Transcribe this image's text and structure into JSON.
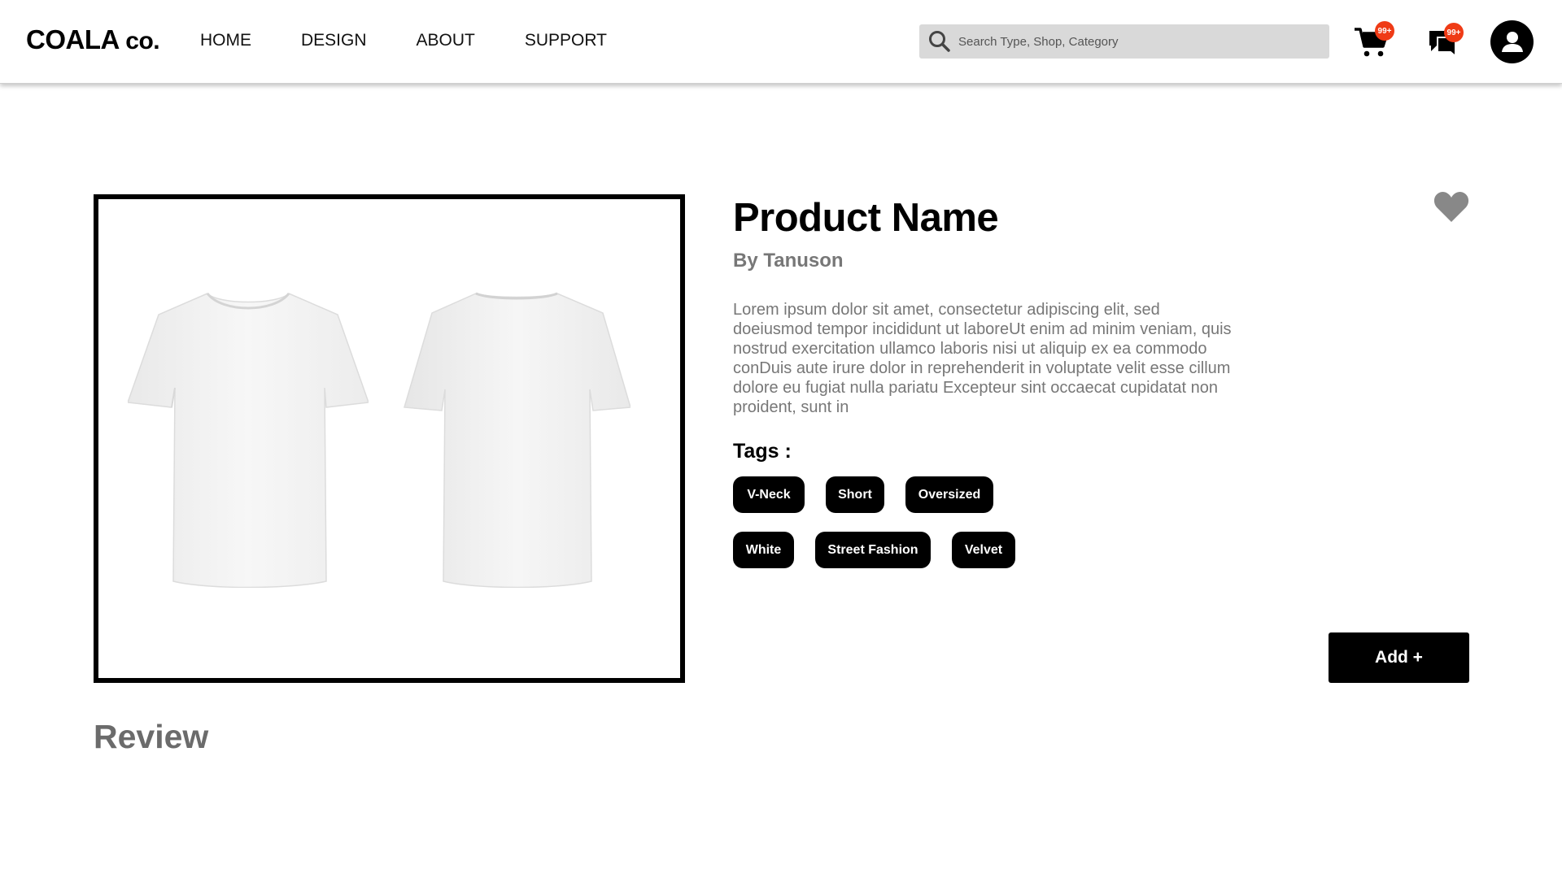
{
  "brand": {
    "name": "COALA",
    "suffix": "co."
  },
  "nav": [
    {
      "label": "HOME"
    },
    {
      "label": "DESIGN"
    },
    {
      "label": "ABOUT"
    },
    {
      "label": "SUPPORT"
    }
  ],
  "search": {
    "placeholder": "Search Type, Shop, Category",
    "value": ""
  },
  "icons": {
    "cart": "cart-icon",
    "chat": "chat-icon",
    "profile": "user-icon",
    "favorite": "heart-icon",
    "search": "search-icon"
  },
  "badges": {
    "cart": "99+",
    "chat": "99+"
  },
  "colors": {
    "badge": "#ef3b16",
    "primary": "#000000",
    "muted": "#777777",
    "search_bg": "#d9d9d9",
    "favorite": "#888888"
  },
  "product": {
    "name": "Product Name",
    "author": "By Tanuson",
    "description": "Lorem ipsum dolor sit amet, consectetur adipiscing elit, sed doeiusmod tempor incididunt ut laboreUt enim ad minim veniam, quis nostrud exercitation ullamco laboris nisi ut aliquip ex ea commodo conDuis aute irure dolor in reprehenderit in voluptate velit esse cillum dolore eu fugiat nulla pariatu Excepteur sint occaecat cupidatat non proident, sunt in",
    "tags_label": "Tags :",
    "tags": [
      "V-Neck",
      "Short",
      "Oversized",
      "White",
      "Street Fashion",
      "Velvet"
    ],
    "add_label": "Add +"
  },
  "review": {
    "title": "Review"
  }
}
